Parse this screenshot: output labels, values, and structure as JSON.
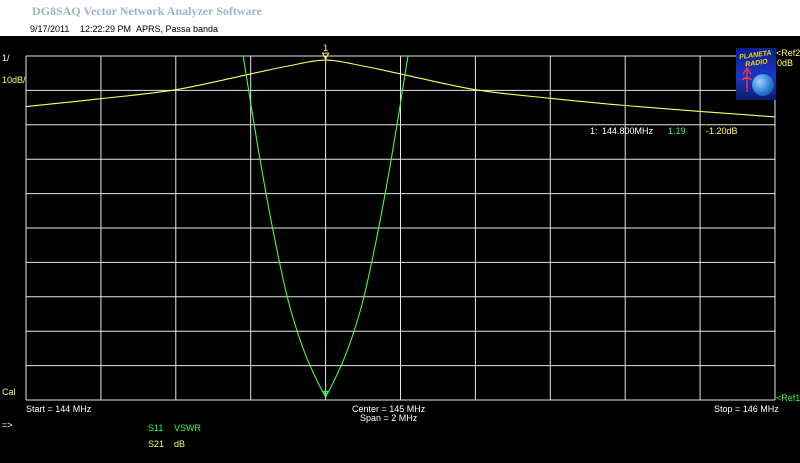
{
  "window": {
    "title": "DG8SAQ Vector Network Analyzer Software"
  },
  "info": {
    "date": "9/17/2011",
    "time": "12:22:29 PM",
    "description": "APRS, Passa banda"
  },
  "left_axis": {
    "top": "1/",
    "scale": "10dB/",
    "bottom": "Cal"
  },
  "right_axis": {
    "ref2": "<Ref2",
    "ref2_value": "0dB",
    "ref1": "<Ref1"
  },
  "freq_axis": {
    "start": "Start = 144 MHz",
    "center": "Center = 145 MHz",
    "span": "Span = 2 MHz",
    "stop": "Stop = 146 MHz"
  },
  "marker": {
    "label": "1",
    "readout": {
      "index": "1:",
      "freq": "144.800MHz",
      "vswr": "1.19",
      "db": "-1.20dB"
    }
  },
  "legend": [
    {
      "param": "S11",
      "format": "VSWR"
    },
    {
      "param": "S21",
      "format": "dB"
    }
  ],
  "cursor_symbol": "=>",
  "colors": {
    "s21": "#ffff60",
    "s11": "#40ff40",
    "grid": "#e6e6e6",
    "background": "#000000"
  },
  "chart_data": {
    "type": "line",
    "xlabel": "",
    "xlim": [
      144,
      146
    ],
    "x_unit": "MHz",
    "series": [
      {
        "name": "S21",
        "format": "dB",
        "color": "#ffff60",
        "ylim": [
          -100,
          0
        ],
        "x": [
          144.0,
          144.2,
          144.4,
          144.6,
          144.7,
          144.8,
          144.9,
          145.0,
          145.2,
          145.4,
          145.6,
          145.8,
          146.0
        ],
        "y": [
          -14.7,
          -12.4,
          -9.8,
          -5.2,
          -2.9,
          -1.2,
          -2.9,
          -5.2,
          -9.8,
          -12.3,
          -14.4,
          -16.1,
          -17.7
        ]
      },
      {
        "name": "S11",
        "format": "VSWR",
        "color": "#40ff40",
        "ylim": [
          1,
          11
        ],
        "x": [
          144.58,
          144.62,
          144.66,
          144.7,
          144.74,
          144.78,
          144.8,
          144.82,
          144.86,
          144.9,
          144.94,
          144.98,
          145.02
        ],
        "y": [
          11.0,
          8.3,
          5.9,
          3.9,
          2.5,
          1.5,
          1.19,
          1.5,
          2.5,
          3.9,
          5.9,
          8.3,
          11.0
        ]
      }
    ],
    "marker_x": 144.8
  }
}
